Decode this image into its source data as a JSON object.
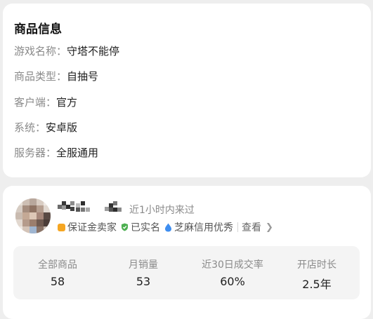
{
  "product_info": {
    "title": "商品信息",
    "rows": [
      {
        "key": "游戏名称：",
        "value": "守塔不能停"
      },
      {
        "key": "商品类型：",
        "value": "自抽号"
      },
      {
        "key": "客户端：",
        "value": "官方"
      },
      {
        "key": "系统：",
        "value": "安卓版"
      },
      {
        "key": "服务器：",
        "value": "全服通用"
      }
    ]
  },
  "seller": {
    "online_status": "近1小时内来过",
    "badges": {
      "deposit": "保证金卖家",
      "verified": "已实名",
      "credit": "芝麻信用优秀"
    },
    "view_label": "查看",
    "colors": {
      "deposit": "#f5a623",
      "verified": "#4caf50",
      "credit": "#3f8ef0"
    },
    "stats": [
      {
        "label": "全部商品",
        "value": "58"
      },
      {
        "label": "月销量",
        "value": "53"
      },
      {
        "label": "近30日成交率",
        "value": "60%"
      },
      {
        "label": "开店时长",
        "value": "2.5年"
      }
    ]
  }
}
